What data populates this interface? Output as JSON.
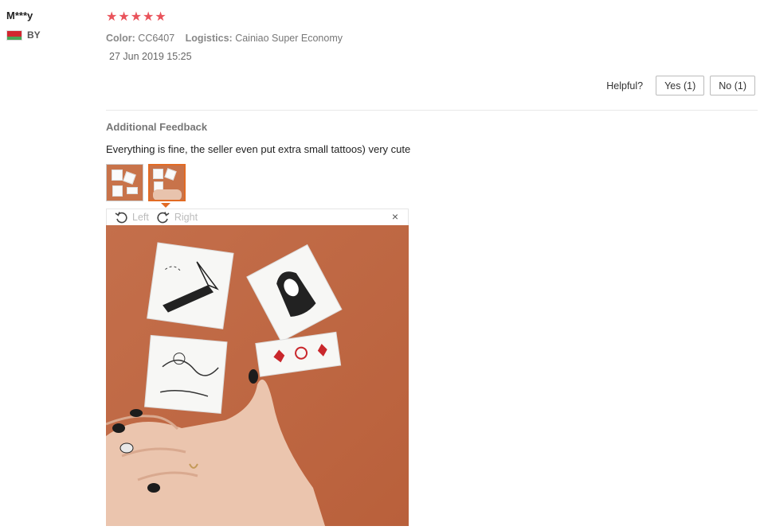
{
  "review": {
    "user_name": "M***y",
    "country": "BY",
    "rating": 5,
    "color_label": "Color:",
    "color_value": "CC6407",
    "logistics_label": "Logistics:",
    "logistics_value": "Cainiao Super Economy",
    "date": "27 Jun 2019 15:25"
  },
  "helpful": {
    "label": "Helpful?",
    "yes": "Yes (1)",
    "no": "No (1)"
  },
  "additional": {
    "title": "Additional Feedback",
    "text": "Everything is fine, the seller even put extra small tattoos) very cute"
  },
  "viewer": {
    "rotate_left": "Left",
    "rotate_right": "Right",
    "close": "×",
    "selected_thumb": 2
  },
  "icons": [
    "star-icon",
    "flag-icon",
    "rotate-left-icon",
    "rotate-right-icon",
    "close-icon"
  ],
  "colors": {
    "star": "#e9535b",
    "accent": "#e26b24",
    "flag_red": "#d22730",
    "flag_green": "#4aa657"
  }
}
